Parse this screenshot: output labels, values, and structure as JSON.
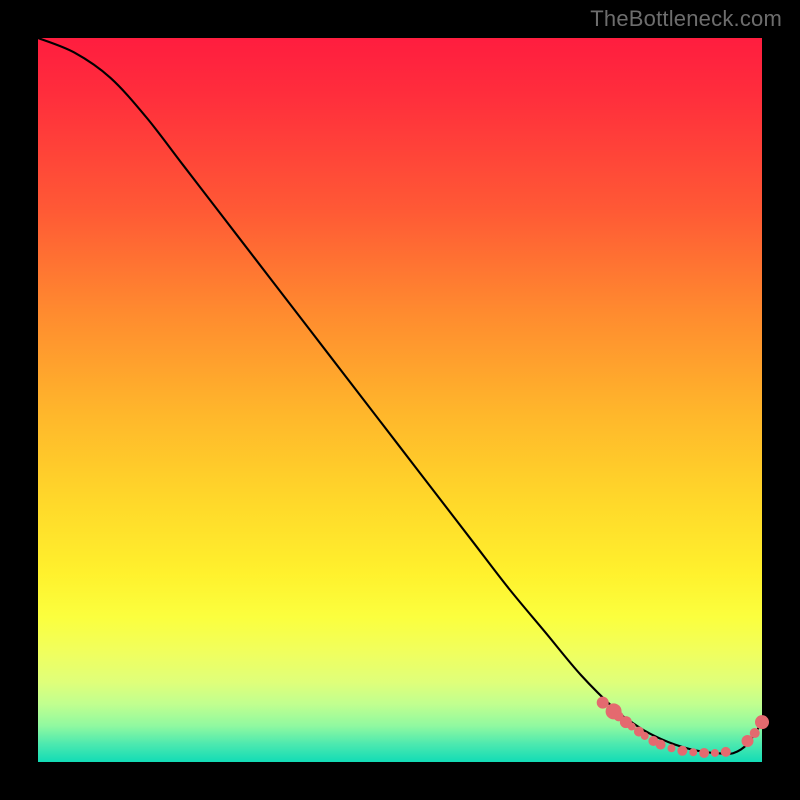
{
  "watermark": "TheBottleneck.com",
  "chart_data": {
    "type": "line",
    "title": "",
    "xlabel": "",
    "ylabel": "",
    "xlim": [
      0,
      100
    ],
    "ylim": [
      0,
      100
    ],
    "grid": false,
    "legend": false,
    "series": [
      {
        "name": "curve",
        "x": [
          0,
          5,
          10,
          15,
          20,
          25,
          30,
          35,
          40,
          45,
          50,
          55,
          60,
          65,
          70,
          75,
          80,
          82,
          84,
          86,
          88,
          90,
          92,
          94,
          96,
          98,
          100
        ],
        "y": [
          100,
          98,
          94.5,
          89,
          82.5,
          76,
          69.5,
          63,
          56.5,
          50,
          43.5,
          37,
          30.5,
          24,
          18,
          12,
          7,
          5.5,
          4.2,
          3.2,
          2.4,
          1.8,
          1.4,
          1.2,
          1.2,
          2.5,
          5.5
        ]
      }
    ],
    "markers": [
      {
        "x": 78,
        "y": 8.2,
        "r": 6
      },
      {
        "x": 79.5,
        "y": 7.0,
        "r": 8
      },
      {
        "x": 80.2,
        "y": 6.3,
        "r": 5
      },
      {
        "x": 81.2,
        "y": 5.5,
        "r": 6
      },
      {
        "x": 82,
        "y": 4.9,
        "r": 4
      },
      {
        "x": 83,
        "y": 4.2,
        "r": 5
      },
      {
        "x": 83.8,
        "y": 3.6,
        "r": 4
      },
      {
        "x": 85,
        "y": 2.9,
        "r": 5
      },
      {
        "x": 86,
        "y": 2.4,
        "r": 5
      },
      {
        "x": 87.5,
        "y": 1.9,
        "r": 4
      },
      {
        "x": 89,
        "y": 1.55,
        "r": 5
      },
      {
        "x": 90.5,
        "y": 1.35,
        "r": 4
      },
      {
        "x": 92,
        "y": 1.25,
        "r": 5
      },
      {
        "x": 93.5,
        "y": 1.25,
        "r": 4
      },
      {
        "x": 95,
        "y": 1.4,
        "r": 5
      },
      {
        "x": 98,
        "y": 2.9,
        "r": 6
      },
      {
        "x": 99,
        "y": 4.0,
        "r": 5
      },
      {
        "x": 100,
        "y": 5.5,
        "r": 7
      }
    ],
    "marker_color": "#e46a6f",
    "curve_color": "#000000",
    "curve_width": 2.1
  }
}
